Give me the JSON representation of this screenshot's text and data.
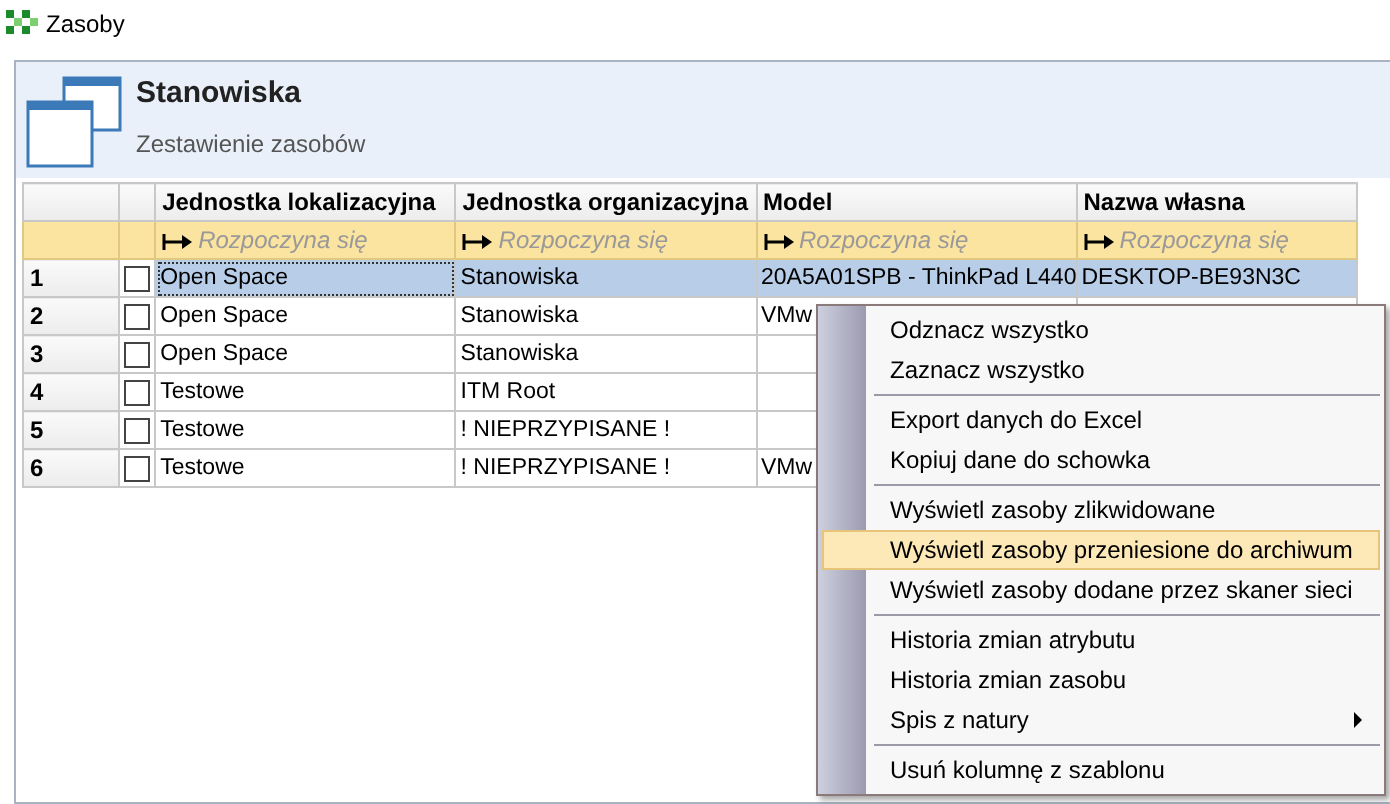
{
  "window": {
    "title": "Zasoby"
  },
  "header": {
    "title": "Stanowiska",
    "subtitle": "Zestawienie zasobów"
  },
  "table": {
    "columns": [
      "Jednostka lokalizacyjna",
      "Jednostka organizacyjna",
      "Model",
      "Nazwa własna"
    ],
    "filters": [
      {
        "placeholder": "Rozpoczyna się"
      },
      {
        "placeholder": "Rozpoczyna się"
      },
      {
        "placeholder": "Rozpoczyna się"
      },
      {
        "placeholder": "Rozpoczyna się"
      }
    ],
    "rows": [
      {
        "number": "1",
        "checked": false,
        "selected": true,
        "cells": [
          "Open Space",
          "Stanowiska",
          "20A5A01SPB - ThinkPad L440",
          "DESKTOP-BE93N3C"
        ]
      },
      {
        "number": "2",
        "checked": false,
        "selected": false,
        "cells": [
          "Open Space",
          "Stanowiska",
          "VMw",
          ""
        ]
      },
      {
        "number": "3",
        "checked": false,
        "selected": false,
        "cells": [
          "Open Space",
          "Stanowiska",
          "",
          ""
        ]
      },
      {
        "number": "4",
        "checked": false,
        "selected": false,
        "cells": [
          "Testowe",
          "ITM Root",
          "",
          ""
        ]
      },
      {
        "number": "5",
        "checked": false,
        "selected": false,
        "cells": [
          "Testowe",
          "! NIEPRZYPISANE !",
          "",
          ""
        ]
      },
      {
        "number": "6",
        "checked": false,
        "selected": false,
        "cells": [
          "Testowe",
          "! NIEPRZYPISANE !",
          "VMw",
          ""
        ]
      }
    ]
  },
  "context_menu": {
    "items": [
      {
        "kind": "item",
        "label": "Odznacz wszystko",
        "selected": false
      },
      {
        "kind": "item",
        "label": "Zaznacz wszystko",
        "selected": false
      },
      {
        "kind": "separator"
      },
      {
        "kind": "item",
        "label": "Export danych do Excel",
        "selected": false
      },
      {
        "kind": "item",
        "label": "Kopiuj dane do schowka",
        "selected": false
      },
      {
        "kind": "separator"
      },
      {
        "kind": "item",
        "label": "Wyświetl zasoby zlikwidowane",
        "selected": false
      },
      {
        "kind": "item",
        "label": "Wyświetl zasoby przeniesione do archiwum",
        "selected": true
      },
      {
        "kind": "item",
        "label": "Wyświetl zasoby dodane przez skaner sieci",
        "selected": false
      },
      {
        "kind": "separator"
      },
      {
        "kind": "item",
        "label": "Historia zmian atrybutu",
        "selected": false
      },
      {
        "kind": "item",
        "label": "Historia zmian zasobu",
        "selected": false
      },
      {
        "kind": "submenu",
        "label": "Spis z natury",
        "selected": false
      },
      {
        "kind": "separator"
      },
      {
        "kind": "item",
        "label": "Usuń kolumnę z szablonu",
        "selected": false
      }
    ]
  }
}
